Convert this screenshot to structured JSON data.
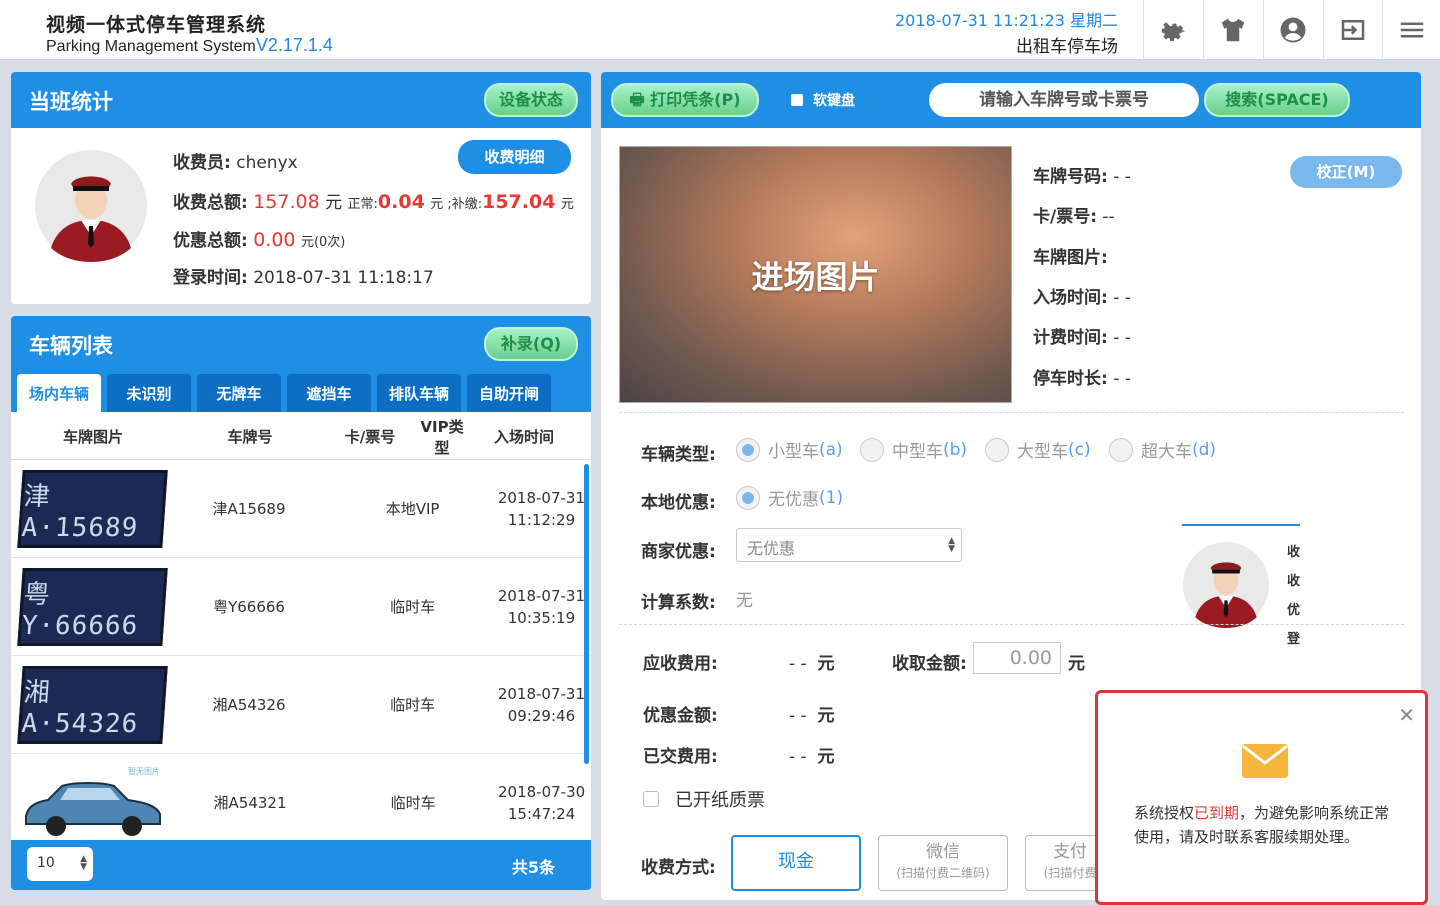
{
  "app": {
    "title": "视频一体式停车管理系统",
    "subtitle": "Parking Management System",
    "version": "V2.17.1.4",
    "datetime": "2018-07-31 11:21:23 星期二",
    "lot_name": "出租车停车场"
  },
  "toolbar_icons": [
    "gear-icon",
    "shirt-icon",
    "user-icon",
    "logout-icon",
    "menu-icon"
  ],
  "stats": {
    "title": "当班统计",
    "device_btn": "设备状态",
    "detail_btn": "收费明细",
    "collector_label": "收费员:",
    "collector": "chenyx",
    "total_label": "收费总额:",
    "total_value": "157.08",
    "unit": "元",
    "normal_label": "正常:",
    "normal_value": "0.04",
    "unit_sep": "元 ;",
    "supp_label": "补缴:",
    "supp_value": "157.04",
    "discount_label": "优惠总额:",
    "discount_value": "0.00",
    "discount_count": "元(0次)",
    "login_label": "登录时间:",
    "login_time": "2018-07-31 11:18:17"
  },
  "vehicles": {
    "title": "车辆列表",
    "add_btn": "补录(Q)",
    "tabs": [
      "场内车辆",
      "未识别",
      "无牌车",
      "遮挡车",
      "排队车辆",
      "自助开闸"
    ],
    "columns": [
      "车牌图片",
      "车牌号",
      "卡/票号",
      "VIP类型",
      "入场时间"
    ],
    "rows": [
      {
        "img_text": "津A·15689",
        "plate": "津A15689",
        "card": "",
        "vip": "本地VIP",
        "date": "2018-07-31",
        "time": "11:12:29"
      },
      {
        "img_text": "粤Y·66666",
        "plate": "粤Y66666",
        "card": "",
        "vip": "临时车",
        "date": "2018-07-31",
        "time": "10:35:19"
      },
      {
        "img_text": "湘A·54326",
        "plate": "湘A54326",
        "card": "",
        "vip": "临时车",
        "date": "2018-07-31",
        "time": "09:29:46"
      },
      {
        "img_text": "暂无图片",
        "plate": "湘A54321",
        "card": "",
        "vip": "临时车",
        "date": "2018-07-30",
        "time": "15:47:24"
      }
    ],
    "page_size": "10",
    "total": "共5条"
  },
  "right": {
    "print_btn": "打印凭条(P)",
    "soft_kb": "软键盘",
    "search_placeholder": "请输入车牌号或卡票号",
    "search_btn": "搜索(SPACE)",
    "entry_img_label": "进场图片",
    "correct_btn": "校正(M)",
    "info": [
      {
        "label": "车牌号码:",
        "value": "- -"
      },
      {
        "label": "卡/票号:",
        "value": "--"
      },
      {
        "label": "车牌图片:",
        "value": ""
      },
      {
        "label": "入场时间:",
        "value": "- -"
      },
      {
        "label": "计费时间:",
        "value": "- -"
      },
      {
        "label": "停车时长:",
        "value": "- -"
      }
    ],
    "vehicle_type_label": "车辆类型:",
    "vehicle_types": [
      {
        "name": "小型车",
        "key": "(a)",
        "checked": true
      },
      {
        "name": "中型车",
        "key": "(b)",
        "checked": false
      },
      {
        "name": "大型车",
        "key": "(c)",
        "checked": false
      },
      {
        "name": "超大车",
        "key": "(d)",
        "checked": false
      }
    ],
    "local_discount_label": "本地优惠:",
    "local_discount": {
      "name": "无优惠",
      "key": "(1)",
      "checked": true
    },
    "merchant_label": "商家优惠:",
    "merchant_value": "无优惠",
    "coef_label": "计算系数:",
    "coef_value": "无",
    "side_chars": [
      "收",
      "收",
      "优",
      "登"
    ],
    "due_label": "应收费用:",
    "due_value": "- -",
    "collect_label": "收取金额:",
    "collect_value": "0.00",
    "disc_label": "优惠金额:",
    "disc_value": "- -",
    "paid_label": "已交费用:",
    "paid_value": "- -",
    "unit": "元",
    "paper_invoice": "已开纸质票",
    "pay_label": "收费方式:",
    "pay_methods": [
      {
        "name": "现金",
        "note": ""
      },
      {
        "name": "微信",
        "note": "(扫描付费二维码)"
      },
      {
        "name": "支付",
        "note": "(扫描付费"
      }
    ]
  },
  "popup": {
    "msg_pre": "系统授权",
    "msg_red": "已到期",
    "msg_post": "，为避免影响系统正常使用，请及时联系客服续期处理。"
  },
  "colors": {
    "primary": "#1f8fe6",
    "accent_red": "#e53935",
    "green_btn": "#68cf90"
  }
}
